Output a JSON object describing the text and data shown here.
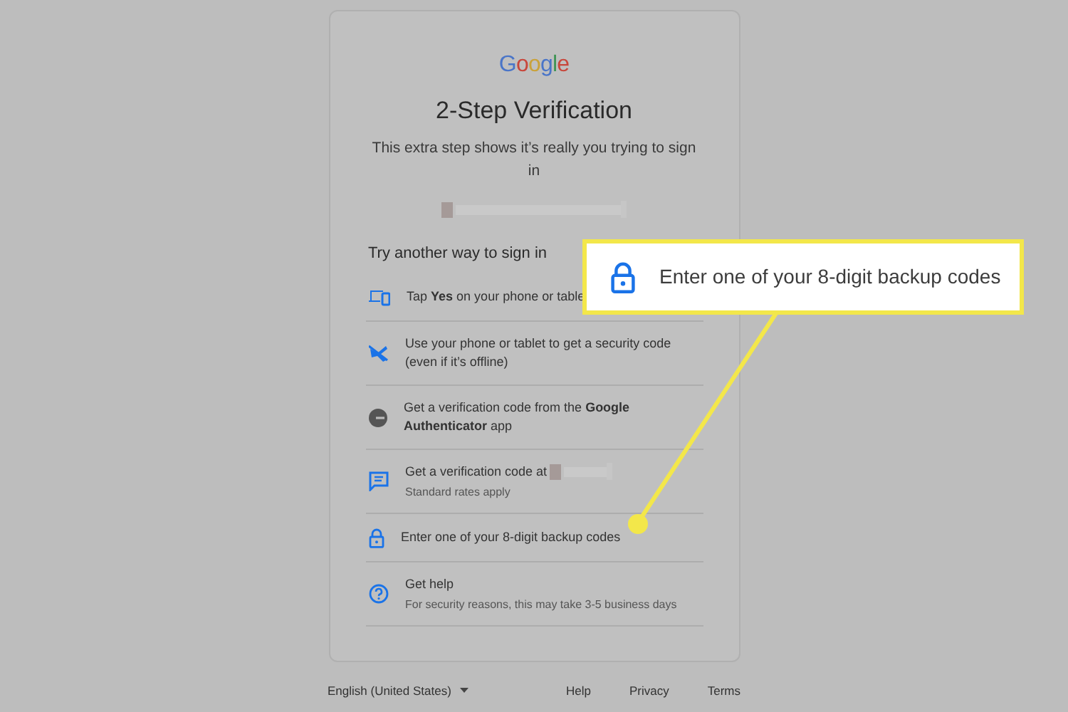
{
  "logo": "Google",
  "title": "2-Step Verification",
  "subtitle": "This extra step shows it’s really you trying to sign in",
  "section_heading": "Try another way to sign in",
  "options": [
    {
      "kind": "device",
      "text": "Tap **Yes** on your phone or table"
    },
    {
      "kind": "phone",
      "text": "Use your phone or tablet to get a security code (even if it’s offline)"
    },
    {
      "kind": "authenticator",
      "text": "Get a verification code from the **Google Authenticator** app"
    },
    {
      "kind": "sms",
      "text": "Get a verification code at",
      "note": "Standard rates apply",
      "redacted": true
    },
    {
      "kind": "lock",
      "text": "Enter one of your 8-digit backup codes"
    },
    {
      "kind": "help",
      "text": "Get help",
      "note": "For security reasons, this may take 3-5 business days"
    }
  ],
  "footer": {
    "language": "English (United States)",
    "links": [
      "Help",
      "Privacy",
      "Terms"
    ]
  },
  "callout": {
    "kind": "lock",
    "text": "Enter one of your 8-digit backup codes"
  }
}
